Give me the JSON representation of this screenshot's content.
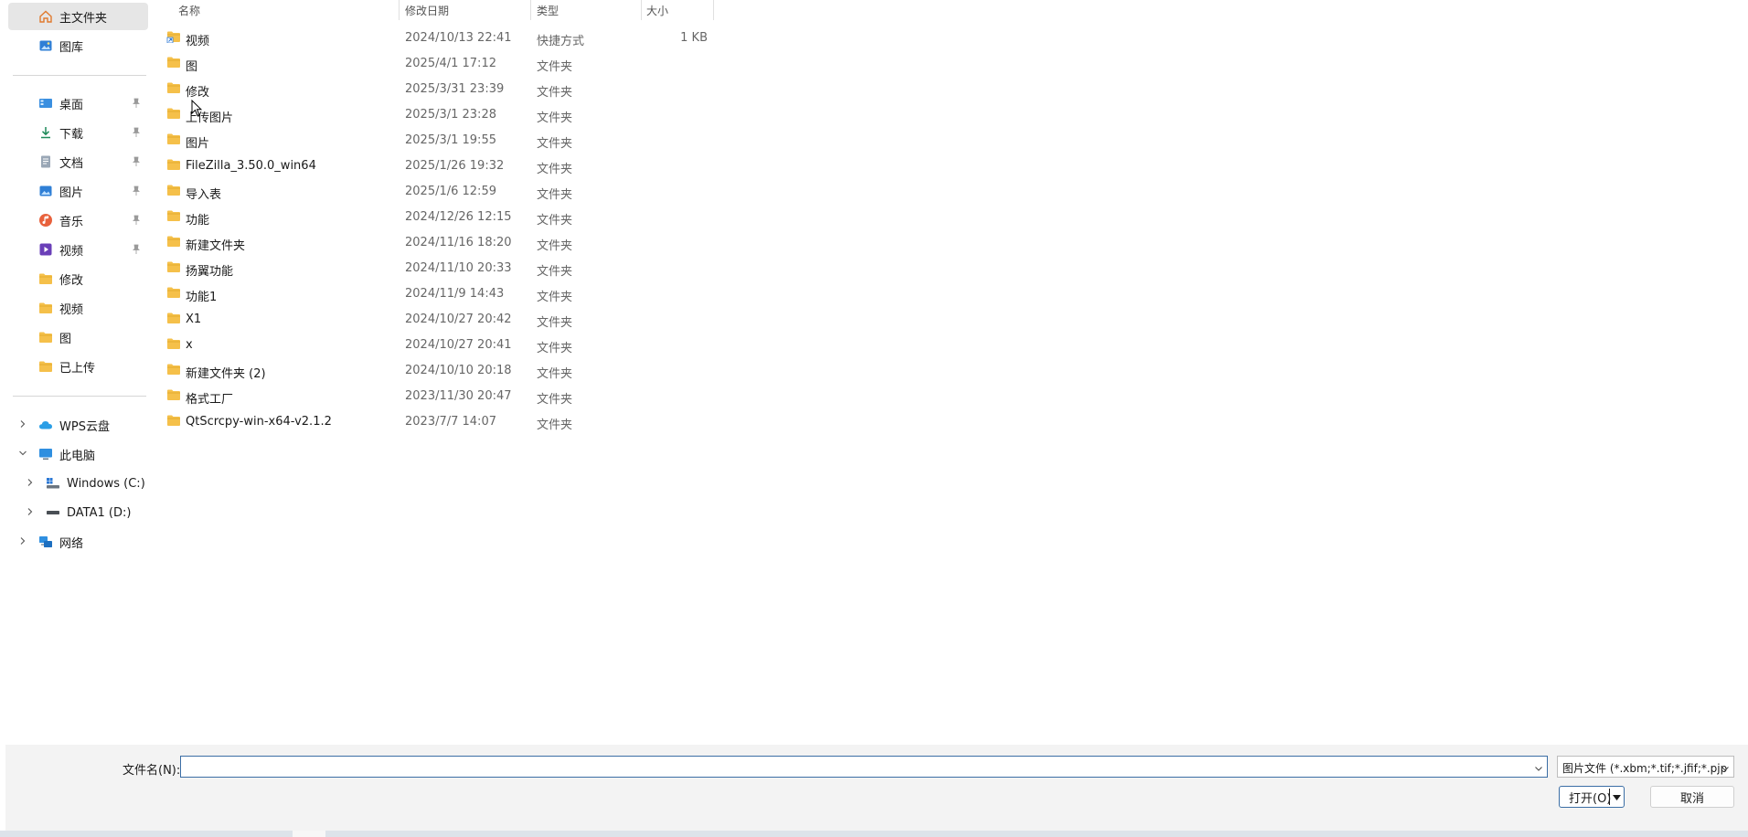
{
  "nav": {
    "items": [
      {
        "label": "主文件夹",
        "icon": "home-icon",
        "selected": true
      },
      {
        "label": "图库",
        "icon": "gallery-icon"
      },
      {
        "label": "桌面",
        "icon": "desktop-icon",
        "pinned": true
      },
      {
        "label": "下载",
        "icon": "download-icon",
        "pinned": true
      },
      {
        "label": "文档",
        "icon": "document-icon",
        "pinned": true
      },
      {
        "label": "图片",
        "icon": "pictures-icon",
        "pinned": true
      },
      {
        "label": "音乐",
        "icon": "music-icon",
        "pinned": true
      },
      {
        "label": "视频",
        "icon": "videos-icon",
        "pinned": true
      },
      {
        "label": "修改",
        "icon": "folder-icon"
      },
      {
        "label": "视频",
        "icon": "folder-icon"
      },
      {
        "label": "图",
        "icon": "folder-icon"
      },
      {
        "label": "已上传",
        "icon": "folder-icon"
      },
      {
        "label": "WPS云盘",
        "icon": "cloud-icon",
        "expander": "collapsed"
      },
      {
        "label": "此电脑",
        "icon": "this-pc-icon",
        "expander": "expanded"
      },
      {
        "label": "Windows (C:)",
        "icon": "windows-drive-icon",
        "expander": "collapsed"
      },
      {
        "label": "DATA1 (D:)",
        "icon": "drive-icon",
        "expander": "collapsed"
      },
      {
        "label": "网络",
        "icon": "network-icon",
        "expander": "collapsed"
      }
    ]
  },
  "columns": {
    "name": "名称",
    "date": "修改日期",
    "type": "类型",
    "size": "大小"
  },
  "files": [
    {
      "name": "视频",
      "date": "2024/10/13 22:41",
      "type": "快捷方式",
      "size": "1 KB",
      "icon": "shortcut-folder-icon"
    },
    {
      "name": "图",
      "date": "2025/4/1 17:12",
      "type": "文件夹",
      "size": "",
      "icon": "folder-icon"
    },
    {
      "name": "修改",
      "date": "2025/3/31 23:39",
      "type": "文件夹",
      "size": "",
      "icon": "folder-icon"
    },
    {
      "name": "上传图片",
      "date": "2025/3/1 23:28",
      "type": "文件夹",
      "size": "",
      "icon": "folder-icon"
    },
    {
      "name": "图片",
      "date": "2025/3/1 19:55",
      "type": "文件夹",
      "size": "",
      "icon": "folder-icon"
    },
    {
      "name": "FileZilla_3.50.0_win64",
      "date": "2025/1/26 19:32",
      "type": "文件夹",
      "size": "",
      "icon": "folder-icon"
    },
    {
      "name": "导入表",
      "date": "2025/1/6 12:59",
      "type": "文件夹",
      "size": "",
      "icon": "folder-icon"
    },
    {
      "name": "功能",
      "date": "2024/12/26 12:15",
      "type": "文件夹",
      "size": "",
      "icon": "folder-icon"
    },
    {
      "name": "新建文件夹",
      "date": "2024/11/16 18:20",
      "type": "文件夹",
      "size": "",
      "icon": "folder-icon"
    },
    {
      "name": "扬翼功能",
      "date": "2024/11/10 20:33",
      "type": "文件夹",
      "size": "",
      "icon": "folder-icon"
    },
    {
      "name": "功能1",
      "date": "2024/11/9 14:43",
      "type": "文件夹",
      "size": "",
      "icon": "folder-icon"
    },
    {
      "name": "X1",
      "date": "2024/10/27 20:42",
      "type": "文件夹",
      "size": "",
      "icon": "folder-icon"
    },
    {
      "name": "x",
      "date": "2024/10/27 20:41",
      "type": "文件夹",
      "size": "",
      "icon": "folder-icon"
    },
    {
      "name": "新建文件夹 (2)",
      "date": "2024/10/10 20:18",
      "type": "文件夹",
      "size": "",
      "icon": "folder-icon"
    },
    {
      "name": "格式工厂",
      "date": "2023/11/30 20:47",
      "type": "文件夹",
      "size": "",
      "icon": "folder-icon"
    },
    {
      "name": "QtScrcpy-win-x64-v2.1.2",
      "date": "2023/7/7 14:07",
      "type": "文件夹",
      "size": "",
      "icon": "folder-icon"
    }
  ],
  "bottom": {
    "filename_label": "文件名(N):",
    "filename_value": "",
    "filter_value": "图片文件 (*.xbm;*.tif;*.jfif;*.pjp",
    "open_label": "打开(O)",
    "cancel_label": "取消"
  },
  "colors": {
    "folder": "#f5c04a",
    "folder_dark": "#e0a526",
    "accent": "#3b6ea5",
    "selected_bg": "#e6e6e6"
  }
}
